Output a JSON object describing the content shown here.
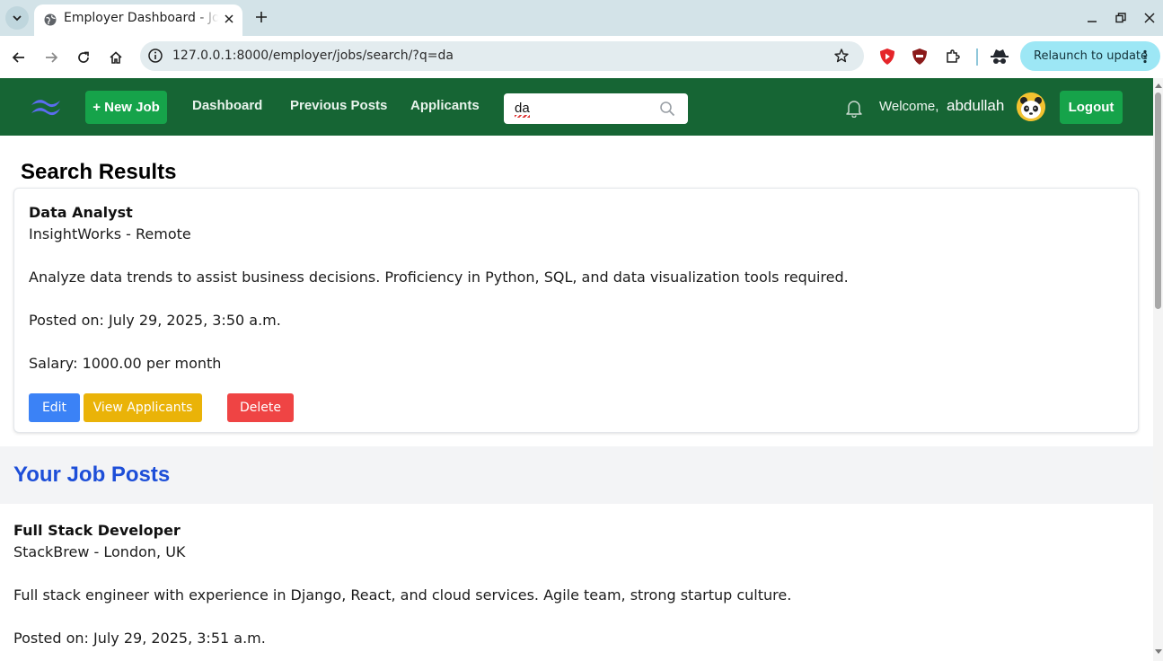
{
  "browser": {
    "tab_title": "Employer Dashboard - Jobs",
    "url": "127.0.0.1:8000/employer/jobs/search/?q=da",
    "relaunch_label": "Relaunch to update"
  },
  "nav": {
    "new_job_label": "+ New Job",
    "links": [
      "Dashboard",
      "Previous Posts",
      "Applicants"
    ],
    "search_value": "da",
    "welcome_label": "Welcome,",
    "username": "abdullah",
    "logout_label": "Logout"
  },
  "results": {
    "heading": "Search Results",
    "job": {
      "title": "Data Analyst",
      "company_location": "InsightWorks - Remote",
      "description": "Analyze data trends to assist business decisions. Proficiency in Python, SQL, and data visualization tools required.",
      "posted": "Posted on: July 29, 2025, 3:50 a.m.",
      "salary": "Salary: 1000.00 per month"
    },
    "actions": {
      "edit": "Edit",
      "view_applicants": "View Applicants",
      "delete": "Delete"
    }
  },
  "job_posts": {
    "heading": "Your Job Posts",
    "items": [
      {
        "title": "Full Stack Developer",
        "company_location": "StackBrew - London, UK",
        "description": "Full stack engineer with experience in Django, React, and cloud services. Agile team, strong startup culture.",
        "posted": "Posted on: July 29, 2025, 3:51 a.m."
      }
    ]
  },
  "colors": {
    "nav_bg": "#166534",
    "primary_green": "#16a34a",
    "edit_blue": "#3b82f6",
    "applicants_yellow": "#eab308",
    "delete_red": "#ef4444",
    "jobs_heading_blue": "#1d4ed8"
  }
}
